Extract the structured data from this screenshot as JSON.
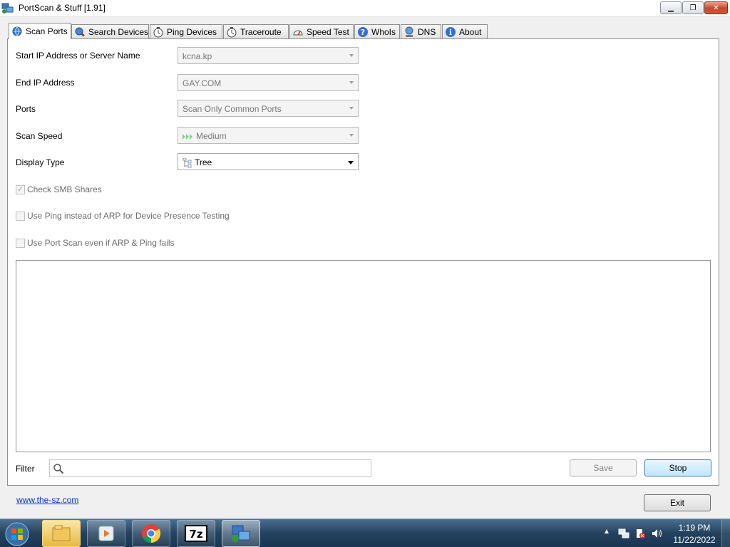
{
  "window": {
    "title": "PortScan & Stuff [1.91]",
    "icon": "network-icon"
  },
  "tabs": [
    {
      "label": "Scan Ports",
      "icon": "globe-icon",
      "active": true
    },
    {
      "label": "Search Devices",
      "icon": "globe-search-icon"
    },
    {
      "label": "Ping Devices",
      "icon": "stopwatch-icon"
    },
    {
      "label": "Traceroute",
      "icon": "stopwatch-icon"
    },
    {
      "label": "Speed Test",
      "icon": "speedometer-icon"
    },
    {
      "label": "WhoIs",
      "icon": "question-icon"
    },
    {
      "label": "DNS",
      "icon": "network-computer-icon"
    },
    {
      "label": "About",
      "icon": "info-icon"
    }
  ],
  "form": {
    "start_ip": {
      "label": "Start IP Address or Server Name",
      "value": "kcna.kp"
    },
    "end_ip": {
      "label": "End IP Address",
      "value": "GAY.COM"
    },
    "ports": {
      "label": "Ports",
      "value": "Scan Only Common Ports"
    },
    "scan_speed": {
      "label": "Scan Speed",
      "value": "Medium",
      "icon": "speed-arrows-icon"
    },
    "display_type": {
      "label": "Display Type",
      "value": "Tree",
      "icon": "tree-icon"
    }
  },
  "checkboxes": {
    "smb": {
      "label": "Check SMB Shares",
      "checked": true
    },
    "ping": {
      "label": "Use Ping instead of ARP for Device Presence Testing",
      "checked": false
    },
    "portscan": {
      "label": "Use Port Scan even if ARP & Ping fails",
      "checked": false
    }
  },
  "filter": {
    "label": "Filter",
    "value": ""
  },
  "buttons": {
    "save": "Save",
    "stop": "Stop",
    "exit": "Exit"
  },
  "footer": {
    "link": "www.the-sz.com"
  },
  "taskbar": {
    "apps": [
      "windows-explorer-icon",
      "media-player-icon",
      "chrome-icon",
      "7zip-icon",
      "portscan-icon"
    ],
    "time": "1:19 PM",
    "date": "11/22/2022"
  },
  "colors": {
    "accent": "#3c7fb1",
    "link": "#0033cc",
    "taskbar": "#24425f"
  }
}
